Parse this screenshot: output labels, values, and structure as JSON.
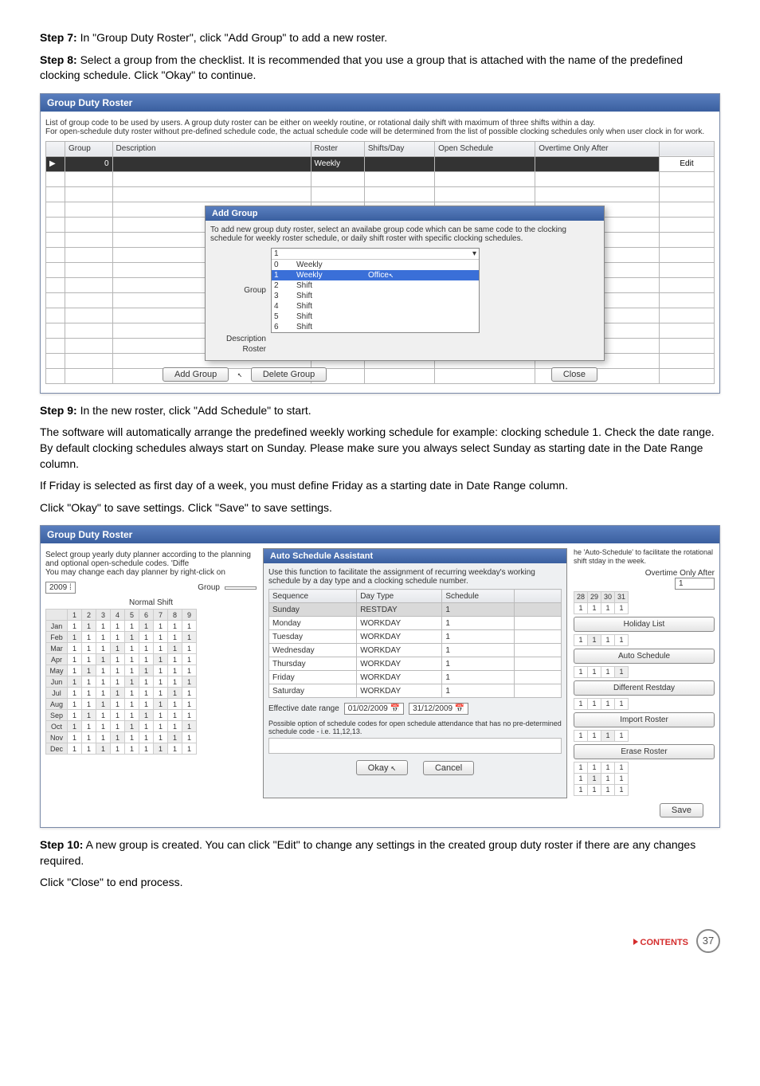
{
  "steps": {
    "s7_label": "Step 7:",
    "s7_text": " In \"Group Duty Roster\", click \"Add Group\" to add  a new roster.",
    "s8_label": "Step 8:",
    "s8_text": " Select a group from the checklist. It is recommended that you use a group that is attached with the name of the predefined clocking schedule. Click \"Okay\" to continue.",
    "s9_label": "Step 9:",
    "s9_text": " In the new roster, click \"Add Schedule\" to start.",
    "p_after9_1": "The software will automatically arrange the predefined weekly working schedule for example: clocking schedule 1. Check the date range. By default clocking schedules always start on Sunday. Please make sure you always select Sunday as starting date in the Date Range column.",
    "p_after9_2": "If Friday is selected as first day of a week, you must define Friday as a starting date in Date Range column.",
    "p_after9_3": "Click \"Okay\" to save settings. Click \"Save\" to save settings.",
    "s10_label": "Step 10:",
    "s10_text": " A new group is created. You can click \"Edit\" to change any settings in the created group duty roster if there are any changes required.",
    "p_close": "Click \"Close\" to end process."
  },
  "ss1": {
    "title": "Group Duty Roster",
    "intro": "List of group code to be used by users. A group duty roster can be either on weekly routine, or rotational daily shift with maximum of three shifts within a day.\nFor open-schedule duty roster without pre-defined schedule code, the actual schedule code will be determined from the list of possible clocking schedules only when user clock in for work.",
    "cols": {
      "group": "Group",
      "desc": "Description",
      "roster": "Roster",
      "shifts": "Shifts/Day",
      "open": "Open Schedule",
      "ot": "Overtime Only After"
    },
    "row1": {
      "group": "0",
      "desc": "",
      "roster": "Weekly",
      "edit": "Edit"
    },
    "dialog": {
      "title": "Add Group",
      "msg": "To add new group duty roster, select an availabe group code which can be same code to the clocking schedule for weekly roster schedule, or daily shift roster with specific clocking schedules.",
      "group_lbl": "Group",
      "desc_lbl": "Description",
      "roster_lbl": "Roster",
      "sel_group": "1",
      "opts": [
        {
          "n": "0",
          "t": "Weekly"
        },
        {
          "n": "1",
          "t": "Weekly",
          "r": "Office",
          "hl": true
        },
        {
          "n": "2",
          "t": "Shift"
        },
        {
          "n": "3",
          "t": "Shift"
        },
        {
          "n": "4",
          "t": "Shift"
        },
        {
          "n": "5",
          "t": "Shift"
        },
        {
          "n": "6",
          "t": "Shift"
        }
      ]
    },
    "btns": {
      "add": "Add Group",
      "del": "Delete Group",
      "close": "Close"
    }
  },
  "ss2": {
    "title": "Group Duty Roster",
    "left_intro": "Select group yearly duty planner according to the planning and optional open-schedule codes. 'Diffe\nYou may change each day planner by right-click on",
    "year": "2009",
    "group_lbl": "Group",
    "normal_shift": "Normal Shift",
    "wk_hdrs": [
      "1",
      "2",
      "3",
      "4",
      "5",
      "6",
      "7",
      "8",
      "9"
    ],
    "months": [
      "Jan",
      "Feb",
      "Mar",
      "Apr",
      "May",
      "Jun",
      "Jul",
      "Aug",
      "Sep",
      "Oct",
      "Nov",
      "Dec"
    ],
    "assist": {
      "title": "Auto Schedule Assistant",
      "msg": "Use this function to facilitate the assignment of recurring weekday's working schedule by a day type and a clocking schedule number.",
      "cols": {
        "seq": "Sequence",
        "dt": "Day Type",
        "sch": "Schedule"
      },
      "rows": [
        {
          "d": "Sunday",
          "t": "RESTDAY",
          "s": "1",
          "hl": true
        },
        {
          "d": "Monday",
          "t": "WORKDAY",
          "s": "1"
        },
        {
          "d": "Tuesday",
          "t": "WORKDAY",
          "s": "1"
        },
        {
          "d": "Wednesday",
          "t": "WORKDAY",
          "s": "1"
        },
        {
          "d": "Thursday",
          "t": "WORKDAY",
          "s": "1"
        },
        {
          "d": "Friday",
          "t": "WORKDAY",
          "s": "1"
        },
        {
          "d": "Saturday",
          "t": "WORKDAY",
          "s": "1"
        }
      ],
      "eff_lbl": "Effective date range",
      "d1": "01/02/2009",
      "d2": "31/12/2009",
      "note": "Possible option of schedule codes for open schedule attendance that has no pre-determined schedule code - i.e. 11,12,13.",
      "ok": "Okay",
      "cancel": "Cancel"
    },
    "right": {
      "note": "he 'Auto-Schedule' to facilitate the rotational shift stday in the week.",
      "ot": "Overtime Only After",
      "ot_grp": "1",
      "hdr": [
        "28",
        "29",
        "30",
        "31"
      ],
      "btns": {
        "hol": "Holiday List",
        "auto": "Auto Schedule",
        "rest": "Different Restday",
        "imp": "Import Roster",
        "erase": "Erase Roster"
      }
    },
    "save": "Save"
  },
  "footer": {
    "contents": "CONTENTS",
    "page": "37"
  }
}
